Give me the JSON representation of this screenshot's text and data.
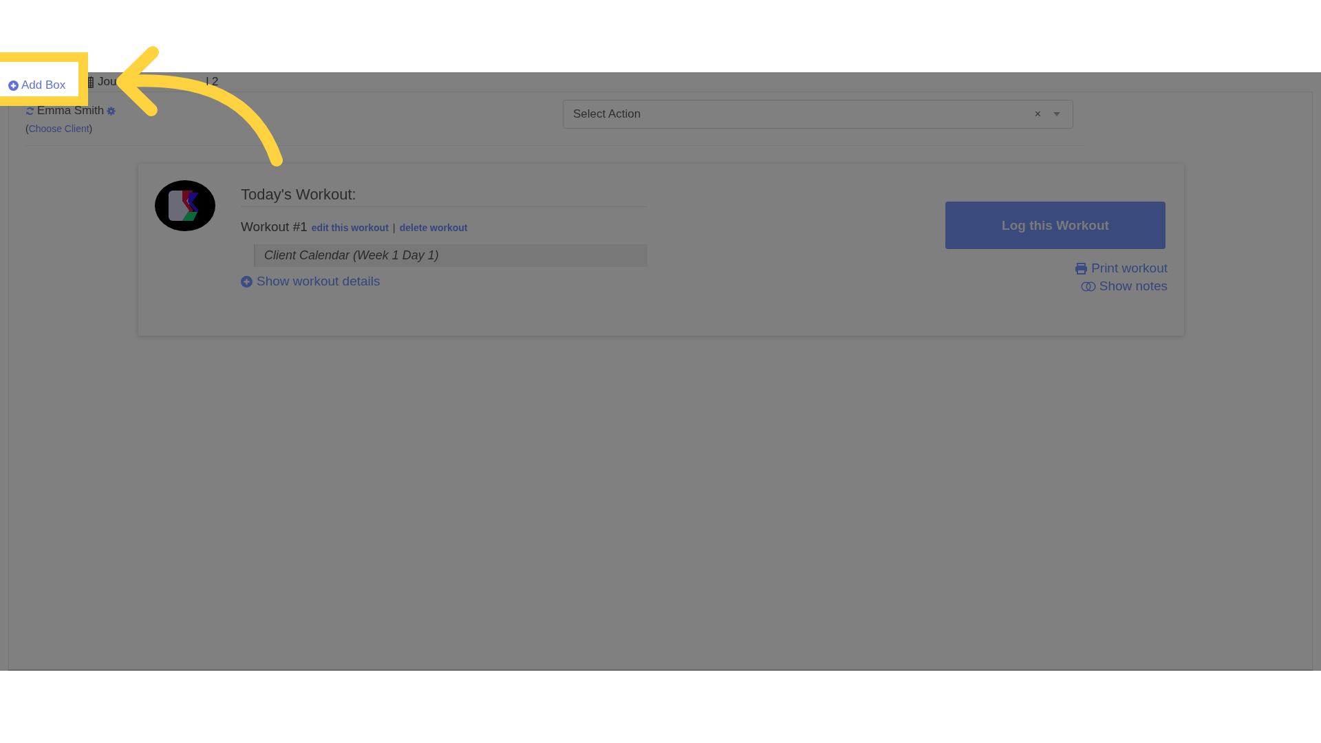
{
  "tabs": [
    {
      "label": "Add Box",
      "kind": "add",
      "highlighted": true
    },
    {
      "label": "Jou",
      "kind": "calendar",
      "highlighted": false
    },
    {
      "label": "l 2",
      "kind": "text",
      "highlighted": false
    }
  ],
  "client": {
    "name": "Emma Smith",
    "before": "(",
    "link": "Choose Client",
    "after": ")"
  },
  "action_select": {
    "placeholder": "Select Action",
    "clear": "×"
  },
  "workout": {
    "heading": "Today's Workout:",
    "title": "Workout #1",
    "links": [
      "edit this workout",
      "delete workout"
    ],
    "separator": "|",
    "program": "Client Calendar (Week 1 Day 1)",
    "details_link": "Show workout details",
    "log_button": "Log this Workout",
    "side_links": [
      {
        "label": "Print workout",
        "kind": "print"
      },
      {
        "label": "Show notes",
        "kind": "notes"
      }
    ]
  }
}
